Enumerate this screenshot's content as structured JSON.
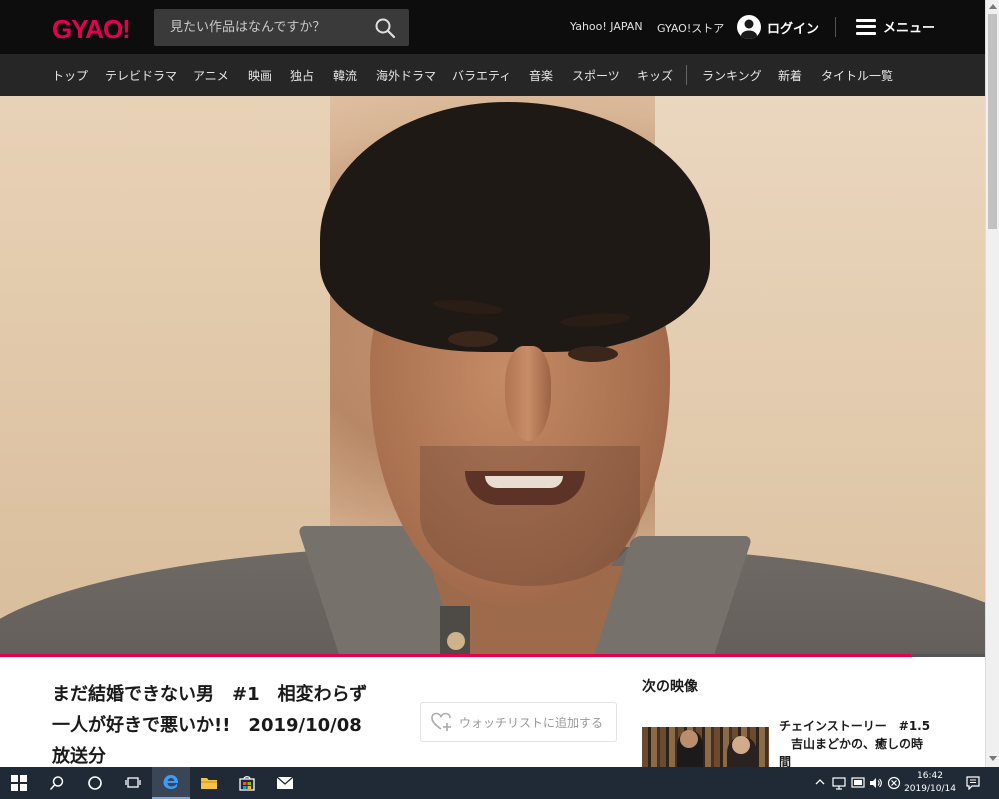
{
  "header": {
    "logo": "GYAO!",
    "search_placeholder": "見たい作品はなんですか？",
    "links": {
      "yahoo": "Yahoo! JAPAN",
      "store": "GYAO!ストア"
    },
    "login_label": "ログイン",
    "menu_label": "メニュー",
    "brand_color": "#e5004f"
  },
  "nav": {
    "items": [
      "トップ",
      "テレビドラマ",
      "アニメ",
      "映画",
      "独占",
      "韓流",
      "海外ドラマ",
      "バラエティ",
      "音楽",
      "スポーツ",
      "キッズ",
      "ランキング",
      "新着",
      "タイトル一覧"
    ]
  },
  "player": {
    "progress_fraction": 0.925
  },
  "episode": {
    "title_lines": [
      "まだ結婚できない男　#1　相変わらず",
      "一人が好きで悪いか!!　2019/10/08",
      "放送分"
    ],
    "watchlist_label": "ウォッチリストに追加する"
  },
  "next": {
    "heading": "次の映像",
    "item_title_lines": [
      "チェインストーリー　#1.5",
      "　吉山まどかの、癒しの時",
      "間"
    ]
  },
  "taskbar": {
    "time": "16:42",
    "date": "2019/10/14"
  }
}
